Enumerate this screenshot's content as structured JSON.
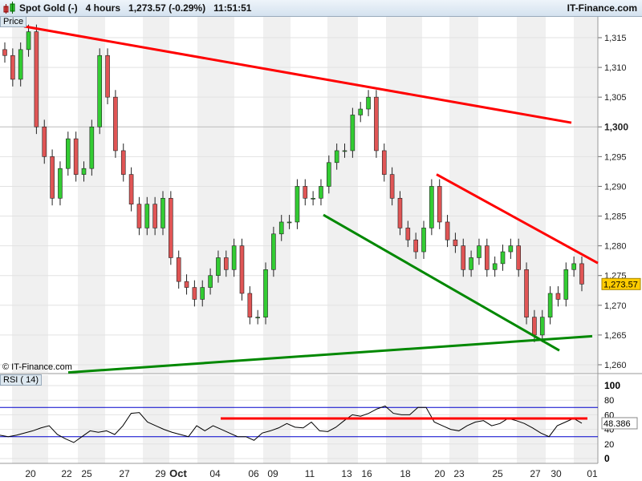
{
  "header": {
    "instrument": "Spot Gold (-)",
    "timeframe": "4 hours",
    "price_change": "1,273.57 (-0.29%)",
    "time": "11:51:51",
    "brand": "IT-Finance.com"
  },
  "watermark": "© IT-Finance.com",
  "colors": {
    "up": "#33cc33",
    "down": "#e05555",
    "resistance": "#ff0000",
    "support": "#008800",
    "rsi_line": "#000000",
    "rsi_level": "#0000cc",
    "last_price_bg": "#ffcc00"
  },
  "chart_data": [
    {
      "type": "candlestick",
      "title": "Price",
      "last_price_label": "1,273.57",
      "y_ticks": [
        "1,260",
        "1,265",
        "1,270",
        "1,275",
        "1,280",
        "1,285",
        "1,290",
        "1,295",
        "1,300",
        "1,305",
        "1,310",
        "1,315"
      ],
      "ylim": [
        1259,
        1318
      ],
      "x_ticks": [
        "20",
        "22",
        "25",
        "27",
        "29",
        "Oct",
        "04",
        "06",
        "09",
        "11",
        "13",
        "16",
        "18",
        "20",
        "23",
        "25",
        "27",
        "30",
        "01"
      ],
      "close": [
        1312,
        1308,
        1313,
        1316,
        1300,
        1295,
        1288,
        1293,
        1298,
        1292,
        1293,
        1300,
        1312,
        1305,
        1296,
        1292,
        1287,
        1283,
        1287,
        1283,
        1288,
        1278,
        1274,
        1273,
        1271,
        1273,
        1275,
        1278,
        1276,
        1280,
        1272,
        1268,
        1268,
        1276,
        1282,
        1284,
        1284,
        1290,
        1288,
        1288,
        1290,
        1294,
        1296,
        1296,
        1302,
        1303,
        1305,
        1296,
        1292,
        1288,
        1283,
        1281,
        1279,
        1283,
        1290,
        1284,
        1281,
        1280,
        1276,
        1278,
        1280,
        1276,
        1277,
        1279,
        1280,
        1276,
        1268,
        1265,
        1268,
        1272,
        1271,
        1276,
        1277,
        1273.57
      ],
      "trendlines": [
        {
          "color": "resistance",
          "from": 1316.9,
          "to": 1300.7
        },
        {
          "color": "resistance",
          "from": 1292.0,
          "to": 1277.1
        },
        {
          "color": "support",
          "from": 1285.2,
          "to": 1262.4
        },
        {
          "color": "support",
          "from": 1258.7,
          "to": 1264.8
        }
      ]
    },
    {
      "type": "line",
      "title": "RSI ( 14)",
      "last_value_label": "48.386",
      "ylim": [
        0,
        100
      ],
      "y_ticks": [
        "0",
        "20",
        "40",
        "60",
        "80",
        "100"
      ],
      "levels": [
        30,
        70
      ],
      "values": [
        32,
        30,
        32,
        35,
        38,
        42,
        45,
        33,
        27,
        22,
        30,
        38,
        36,
        38,
        33,
        45,
        62,
        63,
        50,
        45,
        40,
        36,
        33,
        30,
        45,
        38,
        45,
        40,
        35,
        30,
        30,
        25,
        35,
        38,
        42,
        48,
        43,
        42,
        50,
        38,
        37,
        43,
        52,
        60,
        58,
        62,
        68,
        72,
        62,
        60,
        60,
        70,
        70,
        50,
        45,
        40,
        38,
        45,
        50,
        52,
        45,
        48,
        55,
        52,
        48,
        42,
        35,
        30,
        45,
        50,
        55,
        48.386
      ],
      "horizontal_line": {
        "color": "resistance",
        "value": 55
      }
    }
  ]
}
